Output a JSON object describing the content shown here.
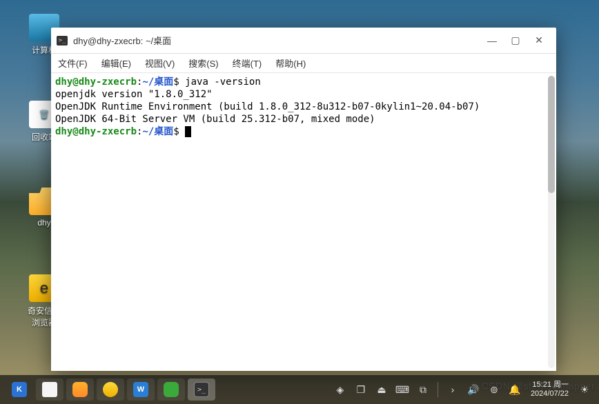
{
  "desktop_icons": {
    "computer": "计算机",
    "trash": "回收站",
    "folder": "dhy",
    "browser1": "奇安信可",
    "browser2": "浏览器"
  },
  "window": {
    "title": "dhy@dhy-zxecrb: ~/桌面",
    "menu": {
      "file": "文件(F)",
      "edit": "编辑(E)",
      "view": "视图(V)",
      "search": "搜索(S)",
      "terminal": "终端(T)",
      "help": "帮助(H)"
    },
    "terminal": {
      "prompt_user": "dhy@dhy-zxecrb",
      "prompt_sep": ":",
      "prompt_path": "~/桌面",
      "prompt_symbol": "$ ",
      "cmd1": "java -version",
      "out1": "openjdk version \"1.8.0_312\"",
      "out2": "OpenJDK Runtime Environment (build 1.8.0_312-8u312-b07-0kylin1~20.04-b07)",
      "out3": "OpenJDK 64-Bit Server VM (build 25.312-b07, mixed mode)"
    }
  },
  "taskbar": {
    "start_letter": "K",
    "w_letter": "W",
    "term_glyph": ">_",
    "clock_time": "15:21 周一",
    "clock_date": "2024/07/22"
  },
  "watermark": "CSDN @sternschnapper"
}
